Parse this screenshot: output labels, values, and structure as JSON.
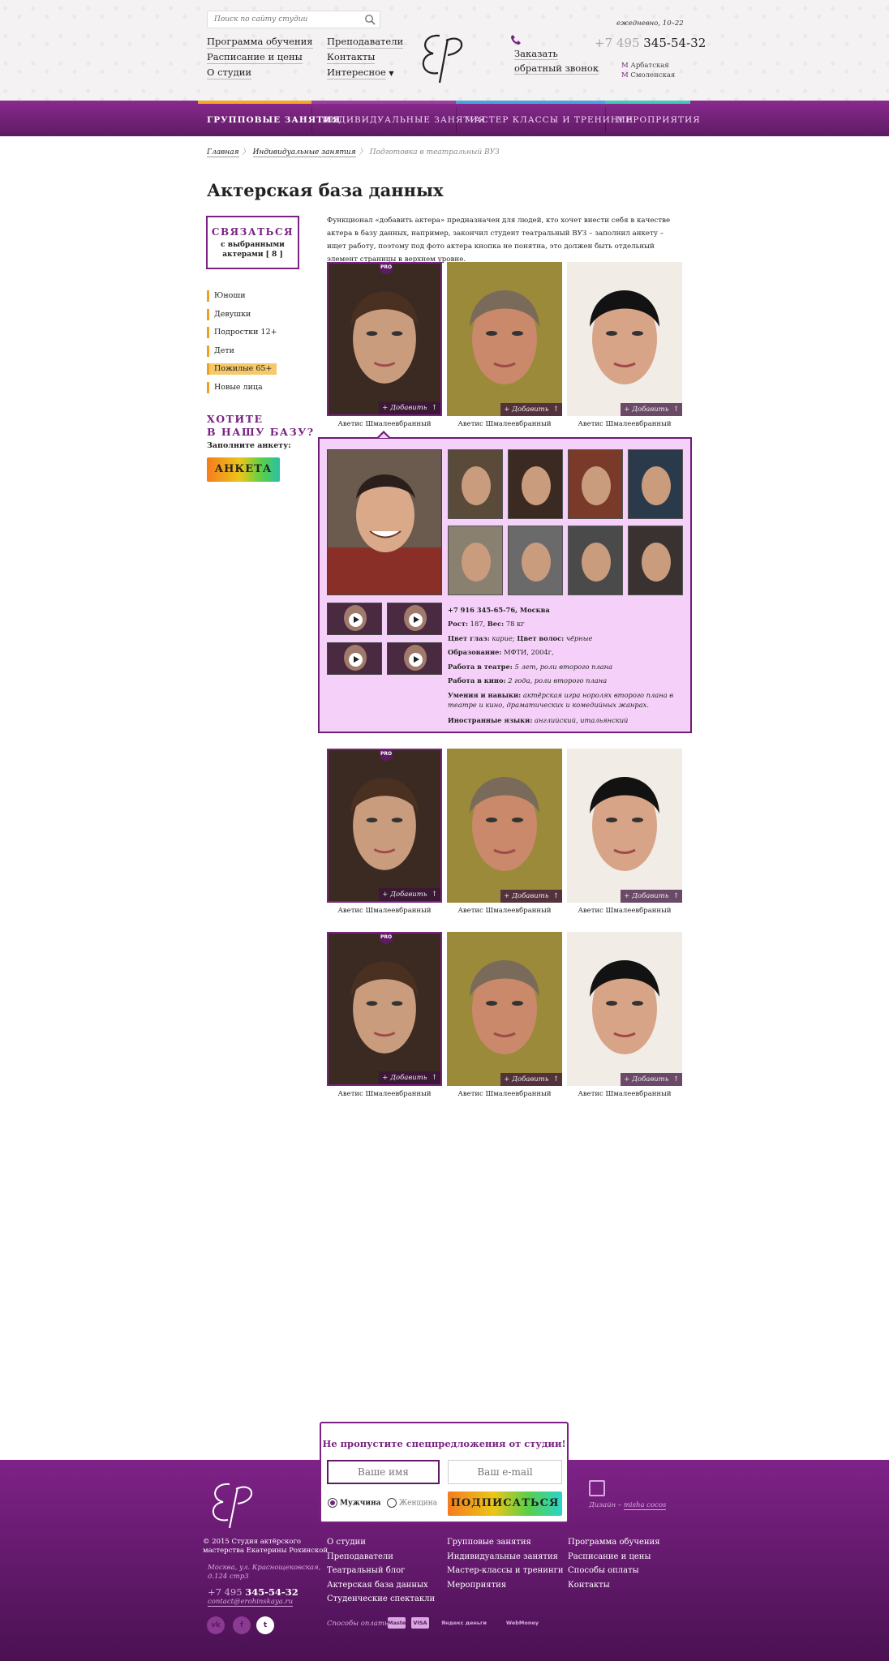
{
  "header": {
    "search_placeholder": "Поиск по сайту студии",
    "links_col1": [
      "Программа обучения",
      "Расписание и цены",
      "О студии"
    ],
    "links_col2": [
      "Преподаватели",
      "Контакты",
      "Интересное"
    ],
    "logo_text": "ЕР",
    "callback": [
      "Заказать",
      "обратный звонок"
    ],
    "hours": "ежедневно, 10–22",
    "phone_code": "+7 495",
    "phone_number": "345-54-32",
    "metro": [
      "Арбатская",
      "Смоленская"
    ]
  },
  "nav": {
    "items": [
      "ГРУППОВЫЕ ЗАНЯТИЯ",
      "ИНДИВИДУАЛЬНЫЕ ЗАНЯТИЯ",
      "МАСТЕР КЛАССЫ И ТРЕНИНГИ",
      "МЕРОПРИЯТИЯ"
    ],
    "stripe_colors": [
      "#f5a623",
      "#9b3fa3",
      "#4aa3e0",
      "#3ec9b8"
    ]
  },
  "breadcrumb": {
    "items": [
      "Главная",
      "Индивидуальные занятия"
    ],
    "current": "Подготовка в театральный ВУЗ"
  },
  "page": {
    "title": "Актерская база данных",
    "intro": "Функционал «добавить актера» предназначен для людей, кто хочет внести себя в качестве актера в базу данных, например, закончил студент театральный ВУЗ – заполнил анкету – ищет работу, поэтому под фото актера кнопка не понятна, это должен быть отдельный элемент страницы в верхнем уровне."
  },
  "sidebar": {
    "contact_title": "СВЯЗАТЬСЯ",
    "contact_sub1": "с выбранными",
    "contact_sub2": "актерами [ 8 ]",
    "categories": [
      "Юноши",
      "Девушки",
      "Подростки 12+",
      "Дети",
      "Пожилые 65+",
      "Новые лица"
    ],
    "want_title": "ХОТИТЕ\nВ НАШУ БАЗУ?",
    "fill_label": "Заполните анкету:",
    "anketa_button": "АНКЕТА"
  },
  "cards": {
    "name": "Аветис Шмалеевбранный",
    "add_label": "Добавить",
    "pro_badge": "PRO"
  },
  "detail": {
    "phone_city": "+7 916 345-65-76, Москва",
    "height_weight_label": "Рост:",
    "height": "187,",
    "weight_label": "Вес:",
    "weight": "78 кг",
    "eyes_label": "Цвет глаз:",
    "eyes": "карие;",
    "hair_label": "Цвет волос:",
    "hair": "чёрные",
    "edu_label": "Образование:",
    "edu": "МФТИ, 2004г,",
    "theatre_label": "Работа в театре:",
    "theatre": "5 лет, роли второго плана",
    "cinema_label": "Работа в кино:",
    "cinema": "2 года, роли второго плана",
    "skills_label": "Умения и навыки:",
    "skills": "актёрская игра норолях второго плана в театре и кино, драматических и комедийных жанрах.",
    "lang_label": "Иностранные языки:",
    "lang": "английский, итальянский"
  },
  "subscribe": {
    "title": "Не пропустите спецпредложения от студии!",
    "name_placeholder": "Ваше имя",
    "email_placeholder": "Ваш e-mail",
    "male": "Мужчина",
    "female": "Женщина",
    "button": "ПОДПИСАТЬСЯ"
  },
  "footer": {
    "copyright": "© 2015 Студия актёрского\nмастерства Екатерины Рохинской",
    "address": "Москва, ул. Краснощековская,\nд.124 стр3",
    "phone_code": "+7 495",
    "phone_number": "345-54-32",
    "email": "contact@erohinskaya.ru",
    "social": [
      "vk",
      "f",
      "t"
    ],
    "col1": [
      "О студии",
      "Преподаватели",
      "Театральный блог",
      "Актерская база данных",
      "Студенческие спектакли"
    ],
    "col2": [
      "Групповые занятия",
      "Индивидуальные занятия",
      "Мастер-классы и тренинги",
      "Мероприятия"
    ],
    "col3": [
      "Программа обучения",
      "Расписание и цены",
      "Способы оплаты",
      "Контакты"
    ],
    "payment_label": "Способы оплаты:",
    "payment_methods": [
      "MasterCard",
      "VISA",
      "Яндекс деньги",
      "WebMoney"
    ],
    "design_prefix": "Дизайн –",
    "design_author": "misha cocos"
  },
  "colors": {
    "brand_purple": "#7a2282",
    "nav_top": "#8a2a8e",
    "nav_bottom": "#5e1a63",
    "detail_bg": "#f5d0f8",
    "category_accent": "#f0a020"
  }
}
